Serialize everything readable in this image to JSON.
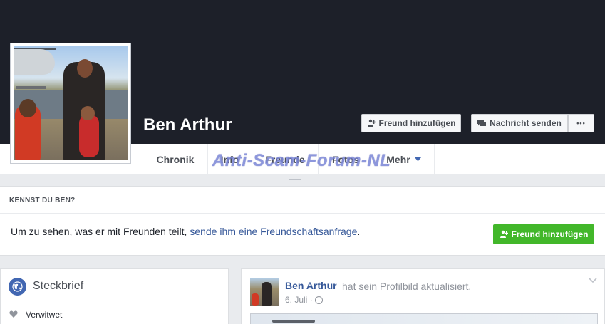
{
  "profile": {
    "name": "Ben Arthur"
  },
  "cover_actions": {
    "add_friend_label": "Freund hinzufügen",
    "message_label": "Nachricht senden",
    "more_label": "•••"
  },
  "tabs": [
    {
      "label": "Chronik",
      "active": true
    },
    {
      "label": "Info"
    },
    {
      "label": "Freunde"
    },
    {
      "label": "Fotos"
    },
    {
      "label": "Mehr"
    }
  ],
  "watermark": "Anti-Scam-Forum-NL",
  "know_card": {
    "header": "KENNST DU BEN?",
    "text_before": "Um zu sehen, was er mit Freunden teilt, ",
    "link_text": "sende ihm eine Freundschaftsanfrage",
    "text_after": ".",
    "button_label": "Freund hinzufügen"
  },
  "intro": {
    "title": "Steckbrief",
    "items": [
      "Verwitwet"
    ]
  },
  "post": {
    "author": "Ben Arthur",
    "action": "hat sein Profilbild aktualisiert.",
    "date": "6. Juli ·"
  },
  "colors": {
    "cover": "#1d2029",
    "link": "#365899",
    "green_button": "#42b72a",
    "watermark": "#7a86d6"
  }
}
